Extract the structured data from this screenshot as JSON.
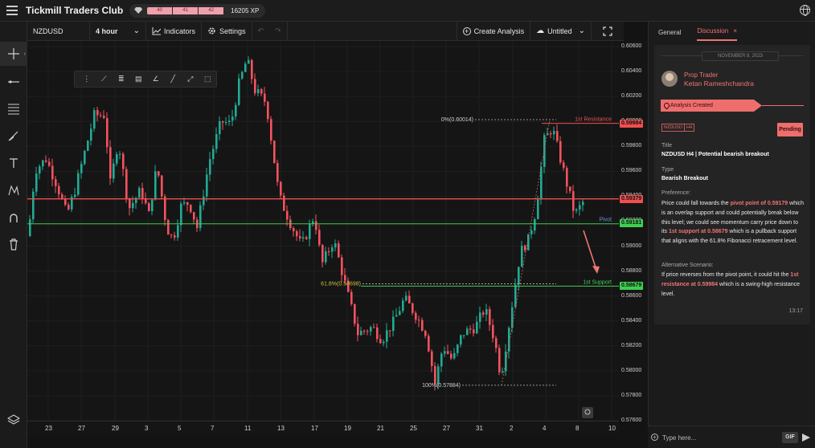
{
  "app": {
    "brand": "Tickmill Traders Club",
    "xp_segments": [
      "40",
      "41",
      "42"
    ],
    "xp_total": "16205 XP"
  },
  "toolbar": {
    "symbol": "NZDUSD",
    "timeframe": "4 hour",
    "indicators_label": "Indicators",
    "settings_label": "Settings",
    "create_analysis_label": "Create Analysis",
    "layout_name": "Untitled"
  },
  "sidebar": {
    "tabs": [
      {
        "label": "General",
        "active": false
      },
      {
        "label": "Discussion",
        "active": true
      }
    ],
    "post": {
      "date": "NOVEMBER 8, 2023",
      "role": "Prop Trader",
      "author": "Ketan Rameshchandra",
      "status": "Analysis Created",
      "tags": [
        "NZDUSD",
        "H4"
      ],
      "state_button": "Pending",
      "title_label": "Title",
      "title": "NZDUSD H4 | Potential bearish breakout",
      "type_label": "Type",
      "type": "Bearish Breakout",
      "preference_label": "Preference:",
      "preference_parts": [
        {
          "text": "Price could fall towards the ",
          "hl": false
        },
        {
          "text": "pivot point of 0.59179",
          "hl": true
        },
        {
          "text": " which is an overlap support and could potentially break below this level; we could see momentum carry price down to its ",
          "hl": false
        },
        {
          "text": "1st support at 0.58679",
          "hl": true
        },
        {
          "text": " which is a pullback support that aligns with the 61.8% Fibonacci retracement level.",
          "hl": false
        }
      ],
      "alternative_label": "Alternative Scenario:",
      "alternative_parts": [
        {
          "text": "If price reverses from the pivot point, it could hit the ",
          "hl": false
        },
        {
          "text": "1st resistance at 0.59984",
          "hl": true
        },
        {
          "text": " which is a swing-high resistance level.",
          "hl": false
        }
      ],
      "time": "13:17"
    },
    "chat_placeholder": "Type here...",
    "gif_label": "GIF"
  },
  "chart_data": {
    "type": "candlestick",
    "symbol": "NZDUSD",
    "timeframe": "4 hour",
    "ylim": [
      0.576,
      0.606
    ],
    "y_ticks": [
      "0.60600",
      "0.60400",
      "0.60200",
      "0.60000",
      "0.59800",
      "0.59600",
      "0.59400",
      "0.59200",
      "0.59000",
      "0.58800",
      "0.58600",
      "0.58400",
      "0.58200",
      "0.58000",
      "0.57800",
      "0.57600"
    ],
    "x_ticks": [
      "23",
      "27",
      "29",
      "3",
      "5",
      "7",
      "11",
      "13",
      "17",
      "19",
      "21",
      "25",
      "27",
      "31",
      "2",
      "4",
      "8",
      "10"
    ],
    "price_tags": [
      {
        "value": "0.59984",
        "color": "#ef4f4f"
      },
      {
        "value": "0.59379",
        "color": "#ef4f4f"
      },
      {
        "value": "0.59181",
        "color": "#3ecf52"
      },
      {
        "value": "0.58679",
        "color": "#3ecf52"
      }
    ],
    "levels": [
      {
        "label": "1st Resistance",
        "value": 0.59984,
        "color": "#ef4f4f"
      },
      {
        "label": "",
        "value": 0.59379,
        "color": "#ef4f4f"
      },
      {
        "label": "Pivot",
        "value": 0.59179,
        "color": "#3ecf52"
      },
      {
        "label": "1st Support",
        "value": 0.58679,
        "color": "#3ecf52"
      }
    ],
    "fib_labels": [
      {
        "label": "0%(0.60014)",
        "value": 0.60014
      },
      {
        "label": "61.8%(0.58698)",
        "value": 0.58698
      },
      {
        "label": "100%(0.57884)",
        "value": 0.57884
      }
    ],
    "colors": {
      "up": "#22ab94",
      "down": "#f7525f"
    }
  }
}
